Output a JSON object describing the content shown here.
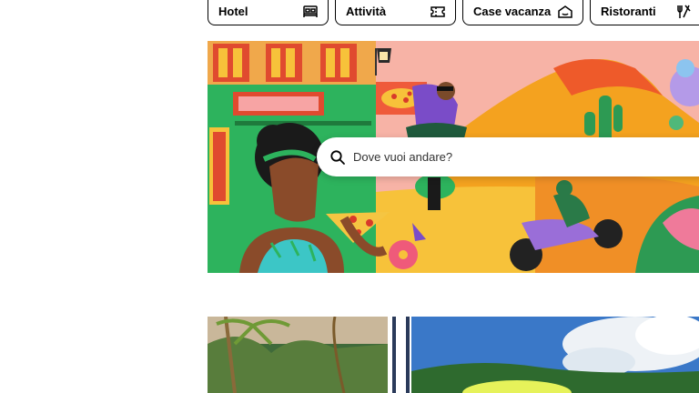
{
  "categories": [
    {
      "label": "Hotel",
      "icon": "bed-icon"
    },
    {
      "label": "Attività",
      "icon": "ticket-icon"
    },
    {
      "label": "Case vacanza",
      "icon": "house-icon"
    },
    {
      "label": "Ristoranti",
      "icon": "cutlery-icon"
    }
  ],
  "search": {
    "placeholder": "Dove vuoi andare?",
    "icon": "search-icon"
  },
  "colors": {
    "border": "#000000",
    "hero_bg": "#f7b0a4",
    "search_bg": "#ffffff"
  }
}
